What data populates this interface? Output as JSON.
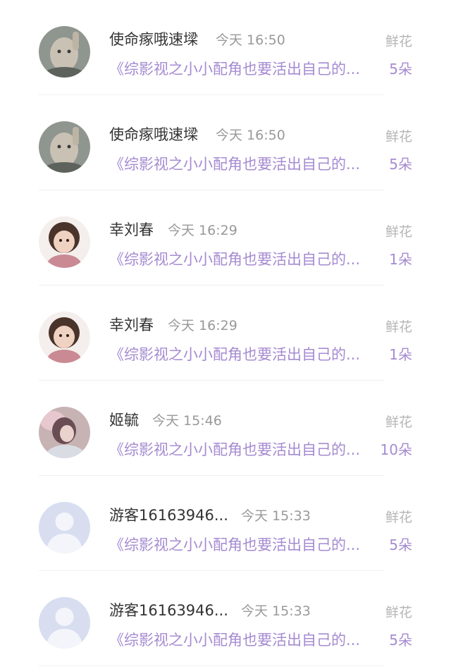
{
  "rows": [
    {
      "name": "使命瘃哦速墚",
      "time": "今天 16:50",
      "book": "《综影视之小小配角也要活出自己的...",
      "gift": "鲜花",
      "count": "5朵",
      "avatar": "photo-child-gray"
    },
    {
      "name": "使命瘃哦速墚",
      "time": "今天 16:50",
      "book": "《综影视之小小配角也要活出自己的...",
      "gift": "鲜花",
      "count": "5朵",
      "avatar": "photo-child-gray"
    },
    {
      "name": "幸刘春",
      "time": "今天 16:29",
      "book": "《综影视之小小配角也要活出自己的...",
      "gift": "鲜花",
      "count": "1朵",
      "avatar": "photo-girl"
    },
    {
      "name": "幸刘春",
      "time": "今天 16:29",
      "book": "《综影视之小小配角也要活出自己的...",
      "gift": "鲜花",
      "count": "1朵",
      "avatar": "photo-girl"
    },
    {
      "name": "姬毓",
      "time": "今天 15:46",
      "book": "《综影视之小小配角也要活出自己的...",
      "gift": "鲜花",
      "count": "10朵",
      "avatar": "photo-woman"
    },
    {
      "name": "游客16163946...",
      "time": "今天 15:33",
      "book": "《综影视之小小配角也要活出自己的...",
      "gift": "鲜花",
      "count": "5朵",
      "avatar": "default-user"
    },
    {
      "name": "游客16163946...",
      "time": "今天 15:33",
      "book": "《综影视之小小配角也要活出自己的...",
      "gift": "鲜花",
      "count": "5朵",
      "avatar": "default-user"
    }
  ],
  "colors": {
    "name": "#333333",
    "time": "#999999",
    "accent": "#a58bd1",
    "gift": "#b5b5b5"
  }
}
